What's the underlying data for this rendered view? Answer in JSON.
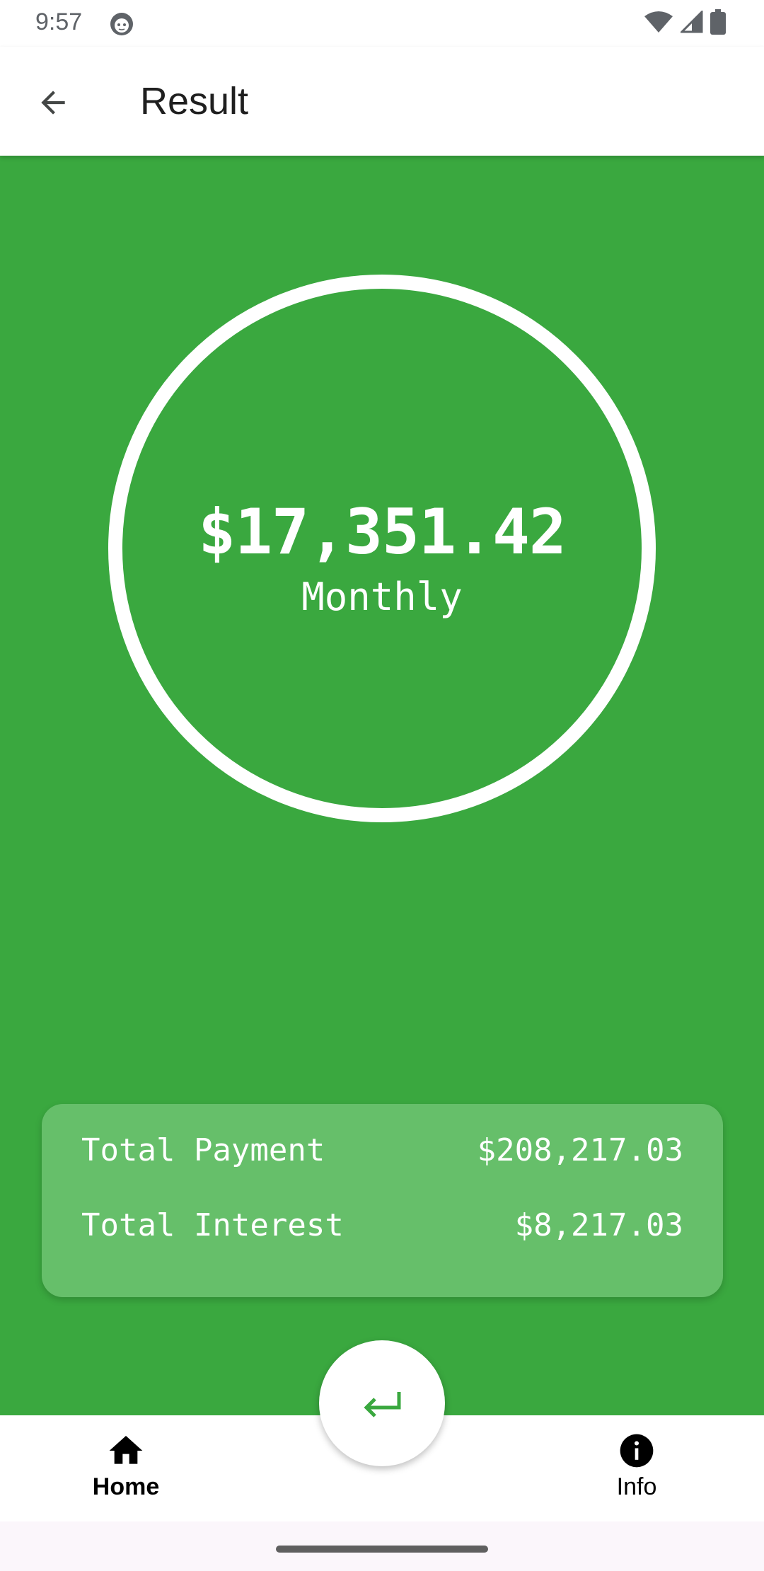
{
  "status_bar": {
    "time": "9:57",
    "icons": [
      "avatar-icon",
      "wifi-icon",
      "signal-icon",
      "battery-icon"
    ]
  },
  "app_bar": {
    "title": "Result",
    "back_icon": "arrow-back-icon"
  },
  "result": {
    "amount": "$17,351.42",
    "period": "Monthly"
  },
  "summary": {
    "rows": [
      {
        "label": "Total Payment",
        "value": "$208,217.03"
      },
      {
        "label": "Total Interest",
        "value": "$8,217.03"
      }
    ]
  },
  "fab": {
    "icon": "keyboard-return-icon"
  },
  "bottom_nav": {
    "items": [
      {
        "label": "Home",
        "icon": "home-icon",
        "selected": true
      },
      {
        "label": "Info",
        "icon": "info-icon",
        "selected": false
      }
    ]
  },
  "colors": {
    "primary_green": "#3aa83f",
    "card_green": "#66bf6a",
    "white": "#ffffff"
  }
}
